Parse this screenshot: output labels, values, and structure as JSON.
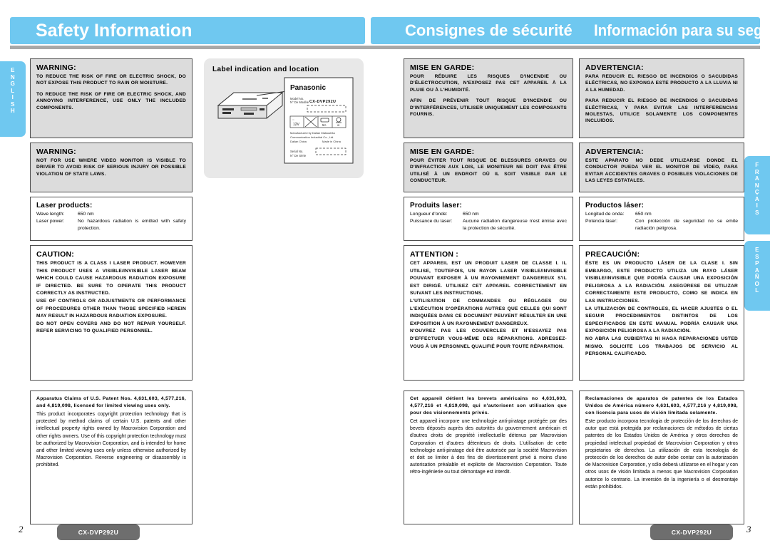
{
  "header": {
    "english_title": "Safety Information",
    "french_title": "Consignes de sécurité",
    "spanish_title": "Información para su seguridad"
  },
  "tabs": {
    "english": "ENGLISH",
    "francais": "FRANÇAIS",
    "espanol": "ESPANOL"
  },
  "english": {
    "warning1_title": "WARNING:",
    "warning1_p1": "TO REDUCE THE RISK OF FIRE OR ELECTRIC SHOCK, DO NOT EXPOSE THIS PRODUCT TO RAIN OR MOISTURE.",
    "warning1_p2": "TO REDUCE THE RISK OF FIRE OR ELECTRIC SHOCK, AND ANNOYING INTERFERENCE, USE ONLY THE INCLUDED COMPONENTS.",
    "warning2_title": "WARNING:",
    "warning2_p1": "NOT FOR USE WHERE VIDEO MONITOR IS VISIBLE TO DRIVER TO AVOID RISK OF SERIOUS INJURY OR POSSIBLE VIOLATION OF STATE LAWS.",
    "laser_title": "Laser products:",
    "laser_key1": "Wave length:",
    "laser_val1": "650 nm",
    "laser_key2": "Laser power:",
    "laser_val2": "No hazardous radiation is emitted with safety protection.",
    "caution_title": "CAUTION:",
    "caution_p1": "THIS PRODUCT IS A CLASS I LASER PRODUCT. HOWEVER THIS PRODUCT USES A VISIBLE/INVISIBLE LASER BEAM WHICH COULD CAUSE HAZARDOUS RADIATION EXPOSURE IF DIRECTED. BE SURE TO OPERATE THIS PRODUCT CORRECTLY AS INSTRUCTED.",
    "caution_p2": "USE OF CONTROLS OR ADJUSTMENTS OR PERFORMANCE OF PROCEDURES OTHER THAN THOSE SPECIFIED HEREIN MAY RESULT IN HAZARDOUS RADIATION EXPOSURE.",
    "caution_p3": "DO NOT OPEN COVERS AND DO NOT REPAIR YOURSELF. REFER SERVICING TO QUALIFIED PERSONNEL.",
    "patent_lead": "Apparatus Claims of U.S. Patent Nos. 4,631,603, 4,577,216, and 4,819,098, licensed for limited viewing uses only.",
    "patent_body": "This product incorporates copyright protection technology that is protected by method claims of certain U.S. patents and other intellectual property rights owned by Macrovision Corporation and other rights owners. Use of this copyright protection technology must be authorized by Macrovision Corporation, and is intended for home and other limited viewing uses only unless otherwise authorized by Macrovision Corporation. Reverse engineering or disassembly is prohibited."
  },
  "label_panel": {
    "title": "Label indication and location",
    "brand": "Panasonic",
    "model_label_en": "Model No.",
    "model_label_fr": "N° De Modèle",
    "model_value": "CX-DVP292U",
    "voltage": "12V",
    "current": "5A",
    "manufacturer_line1": "Manufactured by Dalian Matsushita",
    "manufacturer_line2": "Communication Industrial Co., Ltd.",
    "manufacturer_line3": "Dalian China",
    "made_in": "Made in China",
    "serial_label_en": "Serial No.",
    "serial_label_fr": "N° De Série"
  },
  "french": {
    "warning1_title": "MISE EN GARDE:",
    "warning1_p1": "POUR RÉDUIRE LES RISQUES D'INCENDIE OU D'ÉLECTROCUTION, N'EXPOSEZ PAS CET APPAREIL À LA PLUIE OU À L'HUMIDITÉ.",
    "warning1_p2": "AFIN DE PRÉVENIR TOUT RISQUE D'INCENDIE OU D'INTERFÉRENCES, UTILISER UNIQUEMENT LES COMPOSANTS FOURNIS.",
    "warning2_title": "MISE EN GARDE:",
    "warning2_p1": "POUR ÉVITER TOUT RISQUE DE BLESSURES GRAVES OU D'INFRACTION AUX LOIS, LE MONITEUR NE DOIT PAS ÊTRE UTILISÉ À UN ENDROIT OÙ IL SOIT VISIBLE PAR LE CONDUCTEUR.",
    "laser_title": "Produits laser:",
    "laser_key1": "Longueur d'onde:",
    "laser_val1": "650 nm",
    "laser_key2": "Puissance du laser:",
    "laser_val2": "Aucune radiation dangereuse n'est émise avec la protection de sécurité.",
    "caution_title": "ATTENTION :",
    "caution_p1": "CET APPAREIL EST UN PRODUIT LASER DE CLASSE I. IL UTILISE, TOUTEFOIS, UN RAYON LASER VISIBLE/INVISIBLE POUVANT EXPOSER À UN RAYONNEMENT DANGEREUX S'IL EST DIRIGÉ. UTILISEZ CET APPAREIL CORRECTEMENT EN SUIVANT LES INSTRUCTIONS.",
    "caution_p2": "L'UTILISATION DE COMMANDES OU RÉGLAGES OU L'EXÉCUTION D'OPÉRATIONS AUTRES QUE CELLES QUI SONT INDIQUÉES DANS CE DOCUMENT PEUVENT RÉSULTER EN UNE EXPOSITION À UN RAYONNEMENT DANGEREUX.",
    "caution_p3": "N'OUVREZ PAS LES COUVERCLES ET N'ESSAYEZ PAS D'EFFECTUER VOUS-MÊME DES RÉPARATIONS. ADRESSEZ-VOUS À UN PERSONNEL QUALIFIÉ POUR TOUTE RÉPARATION.",
    "patent_lead": "Cet appareil détient les brevets américains no 4,631,603, 4,577,216 et 4,819,098, qui n'autorisent son utilisation que pour des visionnements privés.",
    "patent_body": "Cet appareil incorpore une technologie anti-piratage protégée par des bevets déposés auprès des autorités du gouvernement américain et d'autres droits de propriété intellectuelle détenus par Macrovision Corporation et d'autres détenteurs de droits. L'utilisation de cette technologie anti-piratage doit être autorisée par la société Macrovision et doit se limiter à des fins de divertissement privé à moins d'une autorisation préalable et explicite de Macrovision Corporation. Toute rétro-ingénierie ou tout démontage est interdit."
  },
  "spanish": {
    "warning1_title": "ADVERTENCIA:",
    "warning1_p1": "PARA REDUCIR EL RIESGO DE INCENDIOS O SACUDIDAS ELÉCTRICAS, NO EXPONGA ESTE PRODUCTO A LA LLUVIA NI A LA HUMEDAD.",
    "warning1_p2": "PARA REDUCIR EL RIESGO DE INCENDIOS O SACUDIDAS ELÉCTRICAS, Y PARA EVITAR LAS INTERFERENCIAS MOLESTAS, UTILICE SOLAMENTE LOS COMPONENTES INCLUIDOS.",
    "warning2_title": "ADVERTENCIA:",
    "warning2_p1": "ESTE APARATO NO DEBE UTILIZARSE DONDE EL CONDUCTOR PUEDA VER EL MONITOR DE VÍDEO, PARA EVITAR ACCIDENTES GRAVES O POSIBLES VIOLACIONES DE LAS LEYES ESTATALES.",
    "laser_title": "Productos láser:",
    "laser_key1": "Longitud de onda:",
    "laser_val1": "650 nm",
    "laser_key2": "Potencia láser:",
    "laser_val2": "Con protección de seguridad no se emite radiación peligrosa.",
    "caution_title": "PRECAUCIÓN:",
    "caution_p1": "ÉSTE ES UN PRODUCTO LÁSER DE LA CLASE I. SIN EMBARGO, ESTE PRODUCTO UTILIZA UN RAYO LÁSER VISIBLE/INVISIBLE QUE PODRÍA CAUSAR UNA EXPOSICIÓN PELIGROSA A LA RADIACIÓN. ASEGÚRESE DE UTILIZAR CORRECTAMENTE ESTE PRODUCTO, COMO SE INDICA EN LAS INSTRUCCIONES.",
    "caution_p2": "LA UTILIZACIÓN DE CONTROLES, EL HACER AJUSTES O EL SEGUIR PROCEDIMIENTOS DISTINTOS DE LOS ESPECIFICADOS EN ESTE MANUAL PODRÍA CAUSAR UNA EXPOSICIÓN PELIGROSA A LA RADIACIÓN.",
    "caution_p3": "NO ABRA LAS CUBIERTAS NI HAGA REPARACIONES USTED MISMO. SOLICITE LOS TRABAJOS DE SERVICIO AL PERSONAL CALIFICADO.",
    "patent_lead": "Reclamaciones de aparatos de patentes de los Estados Unidos de América número 4,631,603, 4,577,216 y 4,819,098, con licencia para usos de visión limitada solamente.",
    "patent_body": "Este producto incorpora tecnologia de protección de los derechos de autor que está protegida por reclamaciones de métodos de ciertas patentes de los Estados Unidos de América y otros derechos de propiedad intelectual propiedad de Macrovision Corporation y otros propietarios de derechos. La utilización de esta tecnología de protección de los derechos de autor debe contar con la autorización de Macrovision Corporation, y sólo deberá utilizarse en el hogar y con otros usos de visión limitada a menos que Macrovision Corporation autorice lo contrario. La inversión de la ingeniería o el desmontaje están prohibidos."
  },
  "footer": {
    "model_badge_left": "CX-DVP292U",
    "model_badge_right": "CX-DVP292U",
    "page_left": "2",
    "page_right": "3"
  },
  "colors": {
    "banner_blue": "#6fc8f0",
    "box_gray": "#dcdcdc",
    "badge_gray": "#6e6e6e"
  }
}
